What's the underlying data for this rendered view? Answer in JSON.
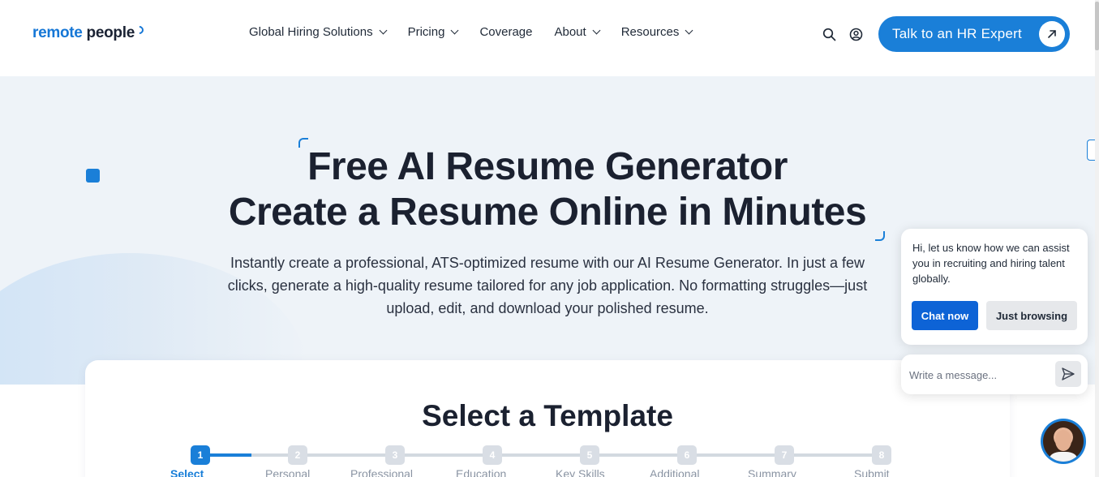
{
  "header": {
    "logo": {
      "part1": "remote",
      "part2": "people"
    },
    "nav": [
      {
        "label": "Global Hiring Solutions",
        "has_dropdown": true
      },
      {
        "label": "Pricing",
        "has_dropdown": true
      },
      {
        "label": "Coverage",
        "has_dropdown": false
      },
      {
        "label": "About",
        "has_dropdown": true
      },
      {
        "label": "Resources",
        "has_dropdown": true
      }
    ],
    "icons": [
      "search-icon",
      "user-account-icon"
    ],
    "cta_label": "Talk to an HR Expert"
  },
  "hero": {
    "title_line1": "Free AI Resume Generator",
    "title_line2": "Create a Resume Online in Minutes",
    "lead": "Instantly create a professional, ATS-optimized resume with our AI Resume Generator. In just a few clicks, generate a high-quality resume tailored for any job application. No formatting struggles—just upload, edit, and download your polished resume."
  },
  "card": {
    "title": "Select a Template",
    "steps": [
      {
        "number": "1",
        "label": "Select"
      },
      {
        "number": "2",
        "label": "Personal"
      },
      {
        "number": "3",
        "label": "Professional"
      },
      {
        "number": "4",
        "label": "Education"
      },
      {
        "number": "5",
        "label": "Key Skills"
      },
      {
        "number": "6",
        "label": "Additional"
      },
      {
        "number": "7",
        "label": "Summary"
      },
      {
        "number": "8",
        "label": "Submit"
      }
    ],
    "active_step": 1
  },
  "chat": {
    "message": "Hi, let us know how we can assist you in recruiting and hiring talent globally.",
    "primary_button": "Chat now",
    "secondary_button": "Just browsing",
    "input_placeholder": "Write a message..."
  },
  "colors": {
    "brand_blue": "#1a7fd8",
    "chat_blue": "#0d63d6",
    "hero_bg": "#eef3f8",
    "text_dark": "#1b2130"
  }
}
